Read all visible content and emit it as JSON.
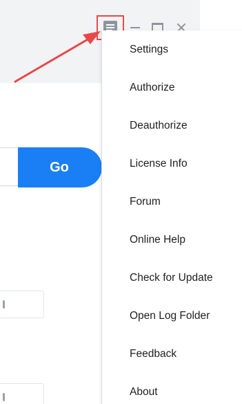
{
  "window_controls": {
    "menu_icon": "hamburger-menu-icon",
    "minimize_icon": "minimize-icon",
    "maximize_icon": "maximize-icon",
    "close_icon": "close-icon"
  },
  "go_button": {
    "label": "Go"
  },
  "menu": {
    "items": [
      "Settings",
      "Authorize",
      "Deauthorize",
      "License Info",
      "Forum",
      "Online Help",
      "Check for Update",
      "Open Log Folder",
      "Feedback",
      "About"
    ]
  },
  "colors": {
    "accent": "#1a7ff5",
    "highlight": "#e8484a",
    "titlebar": "#f2f3f5",
    "icon": "#8e959d"
  }
}
